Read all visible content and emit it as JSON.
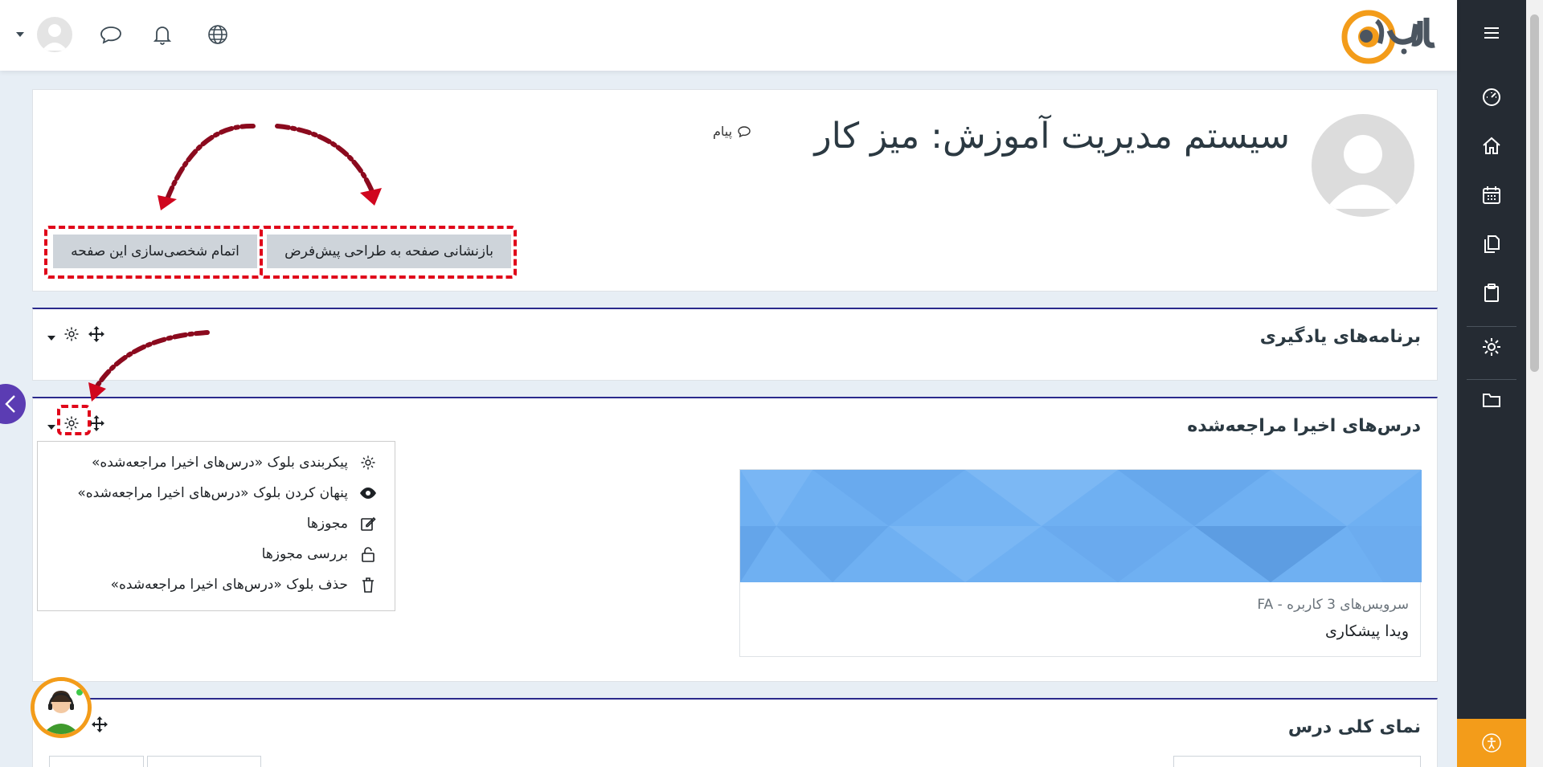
{
  "navbar": {
    "logo_text": "وب@",
    "icons": [
      "user-menu-caret-icon",
      "avatar",
      "chat-icon",
      "bell-icon",
      "globe-icon"
    ]
  },
  "header": {
    "title": "سیستم مدیریت آموزش: میز کار",
    "message_link": "پیام",
    "reset_button": "بازنشانی صفحه به طراحی پیش‌فرض",
    "finish_button": "اتمام شخصی‌سازی این صفحه"
  },
  "blocks": {
    "learning_plans": {
      "title": "برنامه‌های یادگیری"
    },
    "recent_courses": {
      "title": "درس‌های اخیرا مراجعه‌شده"
    },
    "course_overview": {
      "title": "نمای کلی درس"
    }
  },
  "dropdown": {
    "items": [
      {
        "label": "پیکربندی بلوک «درس‌های اخیرا مراجعه‌شده»",
        "icon": "gear-icon"
      },
      {
        "label": "پنهان کردن بلوک «درس‌های اخیرا مراجعه‌شده»",
        "icon": "eye-icon"
      },
      {
        "label": "مجوزها",
        "icon": "edit-icon"
      },
      {
        "label": "بررسی مجوزها",
        "icon": "unlock-icon"
      },
      {
        "label": "حذف بلوک «درس‌های اخیرا مراجعه‌شده»",
        "icon": "trash-icon"
      }
    ]
  },
  "course": {
    "category": "سرویس‌های 3 کاربره - FA",
    "name": "ویدا پیشکاری"
  },
  "sidebar": {
    "items": [
      "dashboard-icon",
      "home-icon",
      "calendar-icon",
      "files-icon",
      "clipboard-icon",
      "settings-icon",
      "folder-icon"
    ]
  },
  "colors": {
    "rail": "#252b33",
    "accent": "#f39c1a",
    "highlight": "#e0061a",
    "block_border": "#2a2a8c"
  }
}
